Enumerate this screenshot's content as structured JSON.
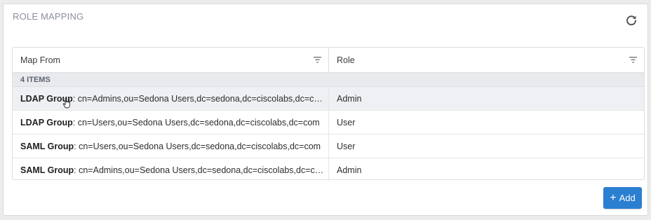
{
  "panel": {
    "title": "ROLE MAPPING"
  },
  "table": {
    "columns": [
      "Map From",
      "Role"
    ],
    "item_count": "4 ITEMS",
    "rows": [
      {
        "type": "LDAP Group",
        "value": ": cn=Admins,ou=Sedona Users,dc=sedona,dc=ciscolabs,dc=com",
        "role": "Admin"
      },
      {
        "type": "LDAP Group",
        "value": ": cn=Users,ou=Sedona Users,dc=sedona,dc=ciscolabs,dc=com",
        "role": "User"
      },
      {
        "type": "SAML Group",
        "value": ": cn=Users,ou=Sedona Users,dc=sedona,dc=ciscolabs,dc=com",
        "role": "User"
      },
      {
        "type": "SAML Group",
        "value": ": cn=Admins,ou=Sedona Users,dc=sedona,dc=ciscolabs,dc=com",
        "role": "Admin"
      }
    ]
  },
  "actions": {
    "add_label": "Add"
  },
  "icons": {
    "refresh": "refresh-icon",
    "filter": "filter-icon",
    "add": "plus-icon"
  },
  "colors": {
    "accent": "#2b7fd0",
    "title": "#8a8f9c",
    "count_bg": "#e8eaee"
  }
}
